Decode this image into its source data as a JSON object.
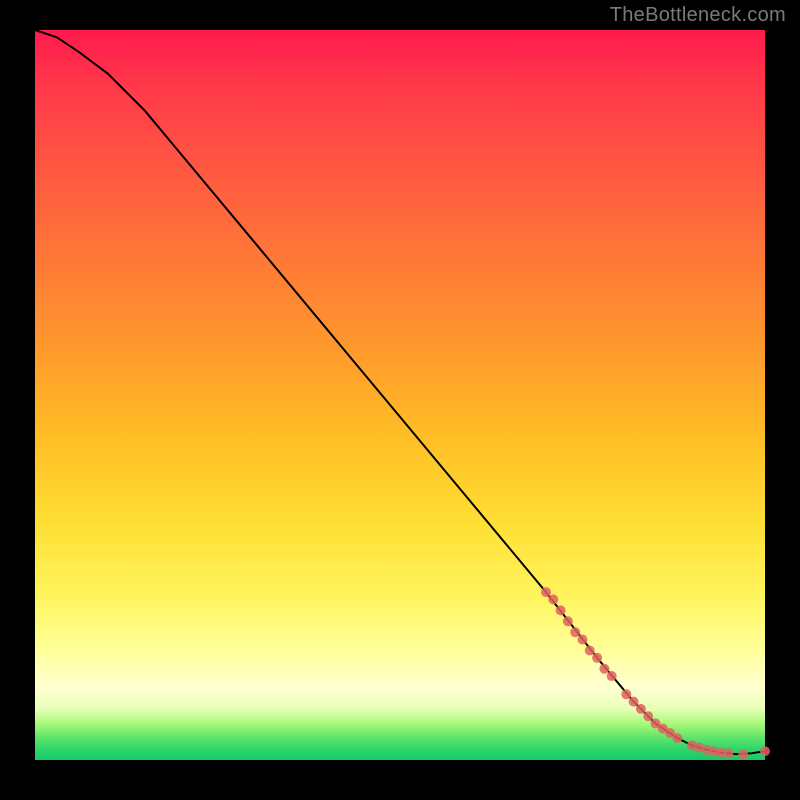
{
  "watermark": "TheBottleneck.com",
  "chart_data": {
    "type": "line",
    "title": "",
    "xlabel": "",
    "ylabel": "",
    "xlim": [
      0,
      100
    ],
    "ylim": [
      0,
      100
    ],
    "grid": false,
    "legend": false,
    "series": [
      {
        "name": "curve",
        "style": "line",
        "color": "#000000",
        "x": [
          0,
          3,
          6,
          10,
          15,
          20,
          30,
          40,
          50,
          60,
          70,
          77,
          82,
          85,
          88,
          90,
          92,
          94,
          96,
          98,
          100
        ],
        "y": [
          100,
          99,
          97,
          94,
          89,
          83,
          71,
          59,
          47,
          35,
          23,
          14,
          8,
          5,
          3,
          2,
          1.4,
          1.0,
          0.8,
          0.9,
          1.2
        ]
      },
      {
        "name": "highlight-points",
        "style": "scatter",
        "color": "#e0615f",
        "x": [
          70,
          71,
          72,
          73,
          74,
          75,
          76,
          77,
          78,
          79,
          81,
          82,
          83,
          84,
          85,
          86,
          87,
          88,
          90,
          91,
          92,
          93,
          94,
          95,
          97,
          100
        ],
        "y": [
          23,
          22,
          20.5,
          19,
          17.5,
          16.5,
          15,
          14,
          12.5,
          11.5,
          9,
          8,
          7,
          6,
          5,
          4.3,
          3.7,
          3,
          2,
          1.7,
          1.4,
          1.2,
          1.0,
          0.9,
          0.8,
          1.2
        ]
      }
    ]
  }
}
